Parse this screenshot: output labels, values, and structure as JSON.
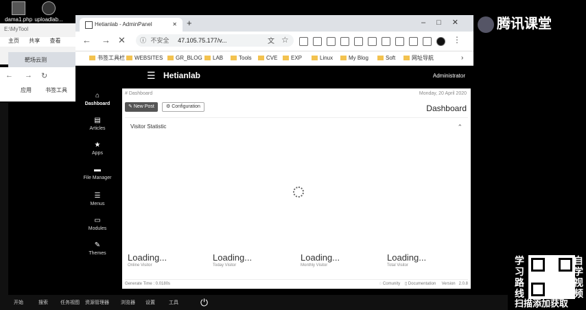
{
  "desktop": {
    "icons": [
      {
        "label": "dama1.php",
        "icon": "php-file-icon"
      },
      {
        "label": "uploadlab...",
        "icon": "zip-file-icon"
      }
    ]
  },
  "explorer": {
    "path": "E:\\MyTool",
    "ribbon": [
      "主页",
      "共享",
      "查看"
    ]
  },
  "bg_tab": {
    "title": "靶场云测"
  },
  "bg_chrome": {
    "bookmarks": [
      "应用",
      "书签工具"
    ]
  },
  "browser": {
    "tab_title": "Hetianlab - AdminPanel",
    "new_tab": "+",
    "window_controls": [
      "–",
      "□",
      "✕"
    ],
    "omnibox": {
      "info": "ⓘ",
      "insecure": "不安全",
      "url": "47.105.75.177/v..."
    },
    "bookmarks": [
      "书签工具栏",
      "WEBSITES",
      "GR_BLOG",
      "LAB",
      "Tools",
      "CVE",
      "EXP",
      "Linux",
      "My Blog",
      "Soft",
      "网址导航"
    ]
  },
  "admin": {
    "brand": "Hetianlab",
    "user": "Administrator",
    "sidebar": [
      {
        "label": "Dashboard",
        "icon": "home-icon",
        "active": true
      },
      {
        "label": "Articles",
        "icon": "articles-icon"
      },
      {
        "label": "Apps",
        "icon": "star-icon"
      },
      {
        "label": "File Manager",
        "icon": "folder-icon"
      },
      {
        "label": "Menus",
        "icon": "list-icon"
      },
      {
        "label": "Modules",
        "icon": "inbox-icon"
      },
      {
        "label": "Themes",
        "icon": "brush-icon"
      }
    ],
    "breadcrumb": "# Dashboard",
    "date": "Monday, 20 April 2020",
    "buttons": {
      "new_post": "New Post",
      "configuration": "Configuration"
    },
    "page_title": "Dashboard",
    "statistic_title": "Visitor Statistic",
    "stats": [
      {
        "value": "Loading...",
        "label": "Online Visitor"
      },
      {
        "value": "Loading...",
        "label": "Today Visitor"
      },
      {
        "value": "Loading...",
        "label": "Monthly Visitor"
      },
      {
        "value": "Loading...",
        "label": "Total Visitor"
      }
    ],
    "footer": {
      "generate": "Generate Time : 0.0180s",
      "community": "Comunity",
      "documentation": "Documentation",
      "version_label": "Version",
      "version": "2.0.8"
    }
  },
  "overlay": {
    "logo": "腾讯课堂",
    "qr_left": "学习路线",
    "qr_right": "自学视频",
    "qr_caption": "扫描添加获取"
  },
  "taskbar": {
    "items": [
      "开始",
      "搜索",
      "任务视图",
      "资源管理器",
      "浏览器",
      "设置",
      "工具"
    ]
  }
}
